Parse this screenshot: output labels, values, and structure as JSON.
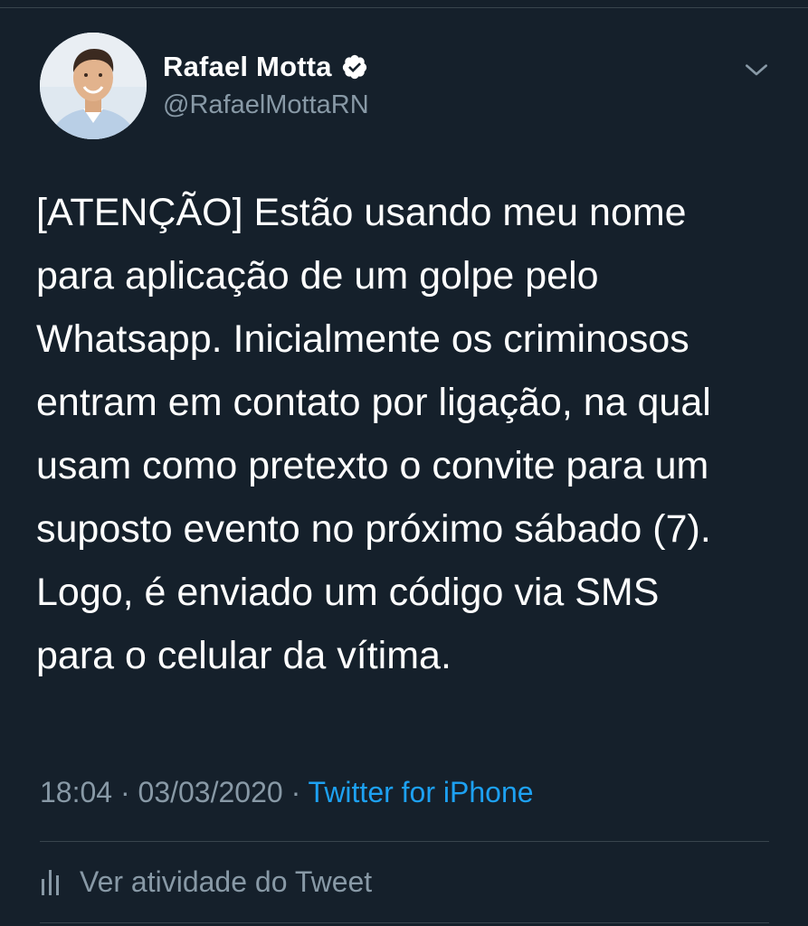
{
  "tweet": {
    "author": {
      "display_name": "Rafael Motta",
      "handle": "@RafaelMottaRN",
      "verified_icon": "verified-badge-icon",
      "avatar": "profile-photo"
    },
    "menu_icon": "chevron-down-icon",
    "text": "[ATENÇÃO] Estão usando meu nome\npara aplicação de um golpe pelo\nWhatsapp. Inicialmente os criminosos\nentram em contato por ligação, na qual\nusam como pretexto o convite para um\nsuposto evento no próximo sábado (7).\nLogo, é enviado um código via SMS\npara o celular da vítima.",
    "time": "18:04",
    "separator": "·",
    "date": "03/03/2020",
    "source": "Twitter for iPhone",
    "activity_label": "Ver atividade do Tweet",
    "activity_icon": "bar-chart-icon"
  },
  "colors": {
    "background": "#15202b",
    "text_primary": "#ffffff",
    "text_secondary": "#8899a6",
    "link": "#1da1f2",
    "divider": "#38444d"
  }
}
